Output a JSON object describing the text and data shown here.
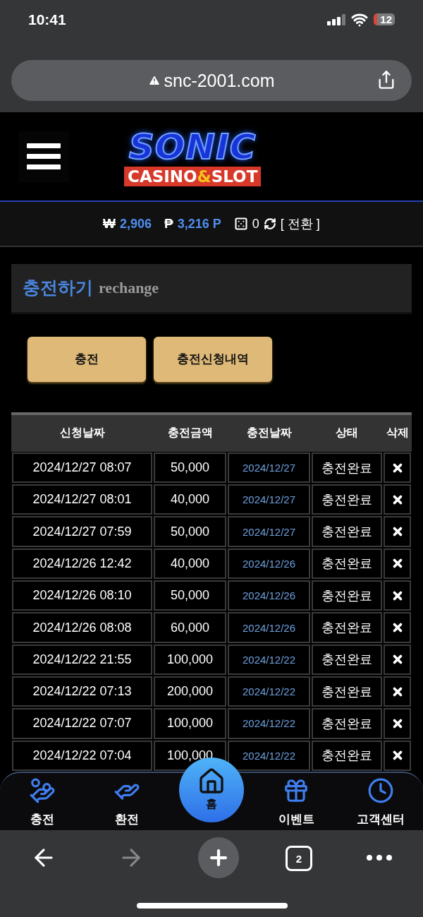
{
  "status_bar": {
    "time": "10:41",
    "battery": "12"
  },
  "browser": {
    "url": "snc-2001.com",
    "tab_count": "2",
    "forward_disabled": true
  },
  "logo": {
    "title": "SONIC",
    "sub_before": "CASINO",
    "sub_accent": "&",
    "sub_after": "SLOT"
  },
  "balance": {
    "money_symbol": "₩",
    "money": "2,906",
    "point_symbol": "₱",
    "point": "3,216 P",
    "chips": "0",
    "convert": "[ 전환 ]"
  },
  "section": {
    "title": "충전하기",
    "subtitle": "rechange"
  },
  "buttons": [
    {
      "label": "충전"
    },
    {
      "label": "충전신청내역"
    }
  ],
  "table": {
    "columns": [
      "신청날짜",
      "충전금액",
      "충전날짜",
      "상태",
      "삭제"
    ],
    "rows": [
      {
        "requested": "2024/12/27 08:07",
        "amount": "50,000",
        "charged": "2024/12/27",
        "status": "충전완료"
      },
      {
        "requested": "2024/12/27 08:01",
        "amount": "40,000",
        "charged": "2024/12/27",
        "status": "충전완료"
      },
      {
        "requested": "2024/12/27 07:59",
        "amount": "50,000",
        "charged": "2024/12/27",
        "status": "충전완료"
      },
      {
        "requested": "2024/12/26 12:42",
        "amount": "40,000",
        "charged": "2024/12/26",
        "status": "충전완료"
      },
      {
        "requested": "2024/12/26 08:10",
        "amount": "50,000",
        "charged": "2024/12/26",
        "status": "충전완료"
      },
      {
        "requested": "2024/12/26 08:08",
        "amount": "60,000",
        "charged": "2024/12/26",
        "status": "충전완료"
      },
      {
        "requested": "2024/12/22 21:55",
        "amount": "100,000",
        "charged": "2024/12/22",
        "status": "충전완료"
      },
      {
        "requested": "2024/12/22 07:13",
        "amount": "200,000",
        "charged": "2024/12/22",
        "status": "충전완료"
      },
      {
        "requested": "2024/12/22 07:07",
        "amount": "100,000",
        "charged": "2024/12/22",
        "status": "충전완료"
      },
      {
        "requested": "2024/12/22 07:04",
        "amount": "100,000",
        "charged": "2024/12/22",
        "status": "충전완료"
      }
    ]
  },
  "bottom_nav": [
    {
      "label": "충전",
      "kind": "deposit",
      "selected": false
    },
    {
      "label": "환전",
      "kind": "withdraw",
      "selected": false
    },
    {
      "label": "홈",
      "kind": "home",
      "selected": true
    },
    {
      "label": "이벤트",
      "kind": "event",
      "selected": false
    },
    {
      "label": "고객센터",
      "kind": "support",
      "selected": false
    }
  ]
}
